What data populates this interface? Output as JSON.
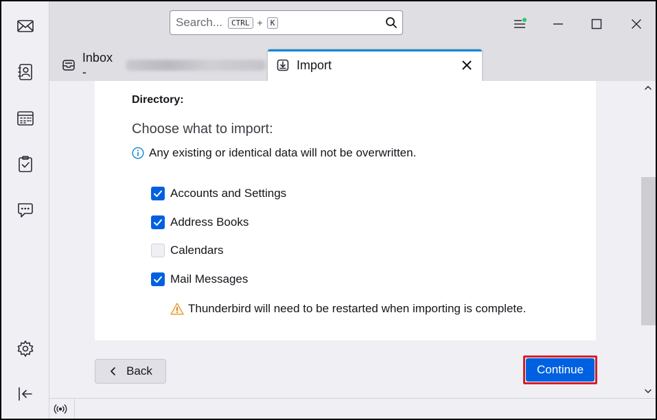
{
  "search": {
    "placeholder": "Search...",
    "shortcut_key1": "CTRL",
    "shortcut_plus": "+",
    "shortcut_key2": "K"
  },
  "tabs": [
    {
      "label": "Inbox -",
      "icon": "inbox-icon",
      "account_redacted": true
    },
    {
      "label": "Import",
      "icon": "import-icon",
      "active": true
    }
  ],
  "spaces": [
    "mail-icon",
    "address-book-icon",
    "calendar-icon",
    "tasks-icon",
    "chat-icon",
    "settings-icon",
    "collapse-icon"
  ],
  "import": {
    "directory_label": "Directory:",
    "heading": "Choose what to import:",
    "info_text": "Any existing or identical data will not be overwritten.",
    "options": [
      {
        "label": "Accounts and Settings",
        "checked": true
      },
      {
        "label": "Address Books",
        "checked": true
      },
      {
        "label": "Calendars",
        "checked": false
      },
      {
        "label": "Mail Messages",
        "checked": true
      }
    ],
    "warning_text": "Thunderbird will need to be restarted when importing is complete."
  },
  "buttons": {
    "back": "Back",
    "continue": "Continue"
  },
  "colors": {
    "accent": "#0061e0",
    "highlight_border": "#d41f2a",
    "tab_indicator": "#0a84d6"
  }
}
